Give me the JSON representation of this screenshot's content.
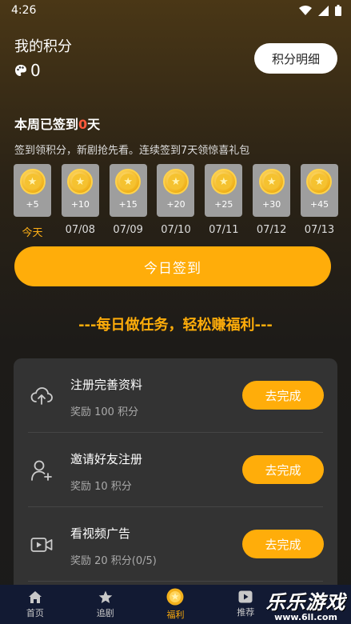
{
  "status_bar": {
    "time": "4:26"
  },
  "points": {
    "label": "我的积分",
    "value": "0",
    "detail_button": "积分明细"
  },
  "signin": {
    "week_prefix": "本周已签到",
    "week_count": "0",
    "week_suffix": "天",
    "description": "签到领积分，新剧抢先看。连续签到7天领惊喜礼包",
    "days": [
      {
        "reward": "+5",
        "label": "今天"
      },
      {
        "reward": "+10",
        "label": "07/08"
      },
      {
        "reward": "+15",
        "label": "07/09"
      },
      {
        "reward": "+20",
        "label": "07/10"
      },
      {
        "reward": "+25",
        "label": "07/11"
      },
      {
        "reward": "+30",
        "label": "07/12"
      },
      {
        "reward": "+45",
        "label": "07/13"
      }
    ],
    "button": "今日签到"
  },
  "tasks": {
    "banner": "---每日做任务，轻松赚福利---",
    "items": [
      {
        "name": "注册完善资料",
        "reward": "奖励 100 积分",
        "button": "去完成",
        "icon": "cloud-upload-icon"
      },
      {
        "name": "邀请好友注册",
        "reward": "奖励 10 积分",
        "button": "去完成",
        "icon": "add-user-icon"
      },
      {
        "name": "看视频广告",
        "reward": "奖励 20 积分(0/5)",
        "button": "去完成",
        "icon": "video-icon"
      }
    ]
  },
  "nav": {
    "items": [
      {
        "label": "首页",
        "icon": "home-icon"
      },
      {
        "label": "追剧",
        "icon": "star-icon"
      },
      {
        "label": "福利",
        "icon": "coin-icon"
      },
      {
        "label": "推荐",
        "icon": "play-icon"
      }
    ]
  },
  "watermark": {
    "title": "乐乐游戏",
    "site": "www.6ll.com"
  },
  "colors": {
    "accent": "#ffad0a",
    "highlight": "#ff5a3c",
    "panel": "#333333",
    "nav_bg": "#121a33"
  }
}
